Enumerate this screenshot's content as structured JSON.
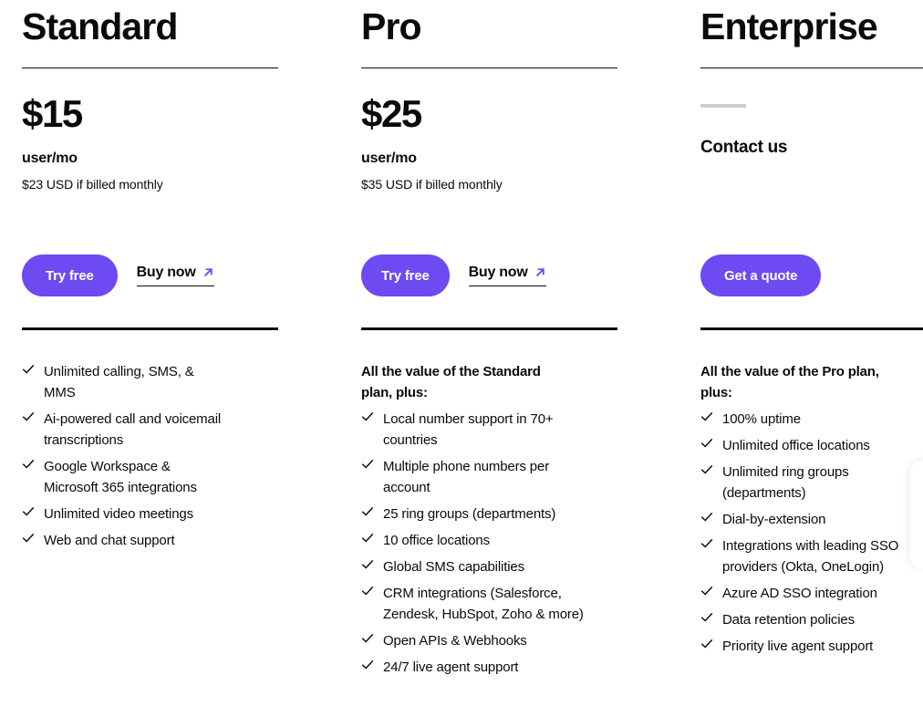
{
  "theme": {
    "accent": "#6d4af2",
    "text": "#0a0a0a",
    "muted_dash": "#cccccc",
    "background": "#ffffff"
  },
  "plans": [
    {
      "id": "standard",
      "name": "Standard",
      "price": "$15",
      "unit": "user/mo",
      "note": "$23 USD if billed monthly",
      "primary_cta": "Try free",
      "secondary_cta": "Buy now",
      "intro": "",
      "features": [
        "Unlimited calling, SMS, & MMS",
        "Ai-powered call and voicemail transcriptions",
        "Google Workspace & Microsoft 365 integrations",
        "Unlimited video meetings",
        "Web and chat support"
      ]
    },
    {
      "id": "pro",
      "name": "Pro",
      "price": "$25",
      "unit": "user/mo",
      "note": "$35 USD if billed monthly",
      "primary_cta": "Try free",
      "secondary_cta": "Buy now",
      "intro": "All the value of the Standard plan, plus:",
      "features": [
        "Local number support in 70+ countries",
        "Multiple phone numbers per account",
        "25 ring groups (departments)",
        "10 office locations",
        "Global SMS capabilities",
        "CRM integrations (Salesforce, Zendesk, HubSpot, Zoho & more)",
        "Open APIs & Webhooks",
        "24/7 live agent support"
      ]
    },
    {
      "id": "enterprise",
      "name": "Enterprise",
      "price": "",
      "unit": "",
      "note": "",
      "contact_label": "Contact us",
      "primary_cta": "Get a quote",
      "secondary_cta": "",
      "intro": "All the value of the Pro plan, plus:",
      "features": [
        "100% uptime",
        "Unlimited office locations",
        "Unlimited ring groups (departments)",
        "Dial-by-extension",
        "Integrations with leading SSO providers (Okta, OneLogin)",
        "Azure AD SSO integration",
        "Data retention policies",
        "Priority live agent support"
      ]
    }
  ]
}
